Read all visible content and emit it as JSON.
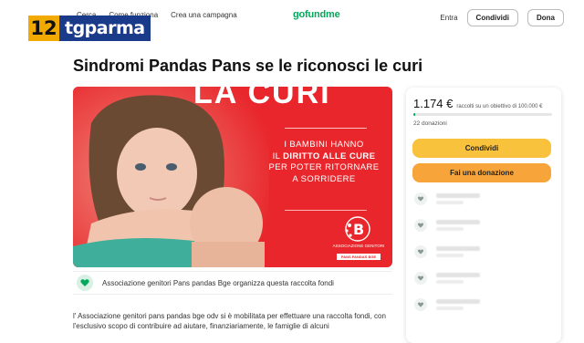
{
  "nav": {
    "item_1": "Cerca",
    "item_2": "Come funziona",
    "item_3": "Crea una campagna",
    "brand": "gofundme",
    "login": "Entra",
    "share": "Condividi",
    "donate": "Dona"
  },
  "watermark": {
    "number": "12",
    "name": "tgparma"
  },
  "campaign": {
    "title": "Sindromi Pandas Pans se le riconosci le curi",
    "hero_heading": "LA CURI",
    "hero_line1": "I BAMBINI HANNO",
    "hero_line2_prefix": "IL ",
    "hero_line2_bold": "DIRITTO ALLE CURE",
    "hero_line3": "PER POTER RITORNARE",
    "hero_line4": "A SORRIDERE",
    "assoc_logo_text": "ASSOCIAZIONE GENITORI",
    "assoc_logo_sub": "PANS PANDAS BGE",
    "organizer": "Associazione genitori Pans pandas Bge organizza questa raccolta fondi",
    "description": "l' Associazione genitori pans pandas bge odv si è mobilitata per effettuare una raccolta fondi, con l'esclusivo scopo di contribuire ad aiutare, finanziariamente, le famiglie di alcuni"
  },
  "card": {
    "amount": "1.174 €",
    "goal_text": "raccolti su un obiettivo di 100.000 €",
    "progress_fraction": 0.012,
    "donations": "22 donazioni",
    "share_button": "Condividi",
    "donate_button": "Fai una donazione"
  },
  "colors": {
    "brand_green": "#02a95c",
    "hero_red": "#e8262b",
    "share_yellow": "#f9c23c",
    "donate_orange": "#f7a53a"
  }
}
